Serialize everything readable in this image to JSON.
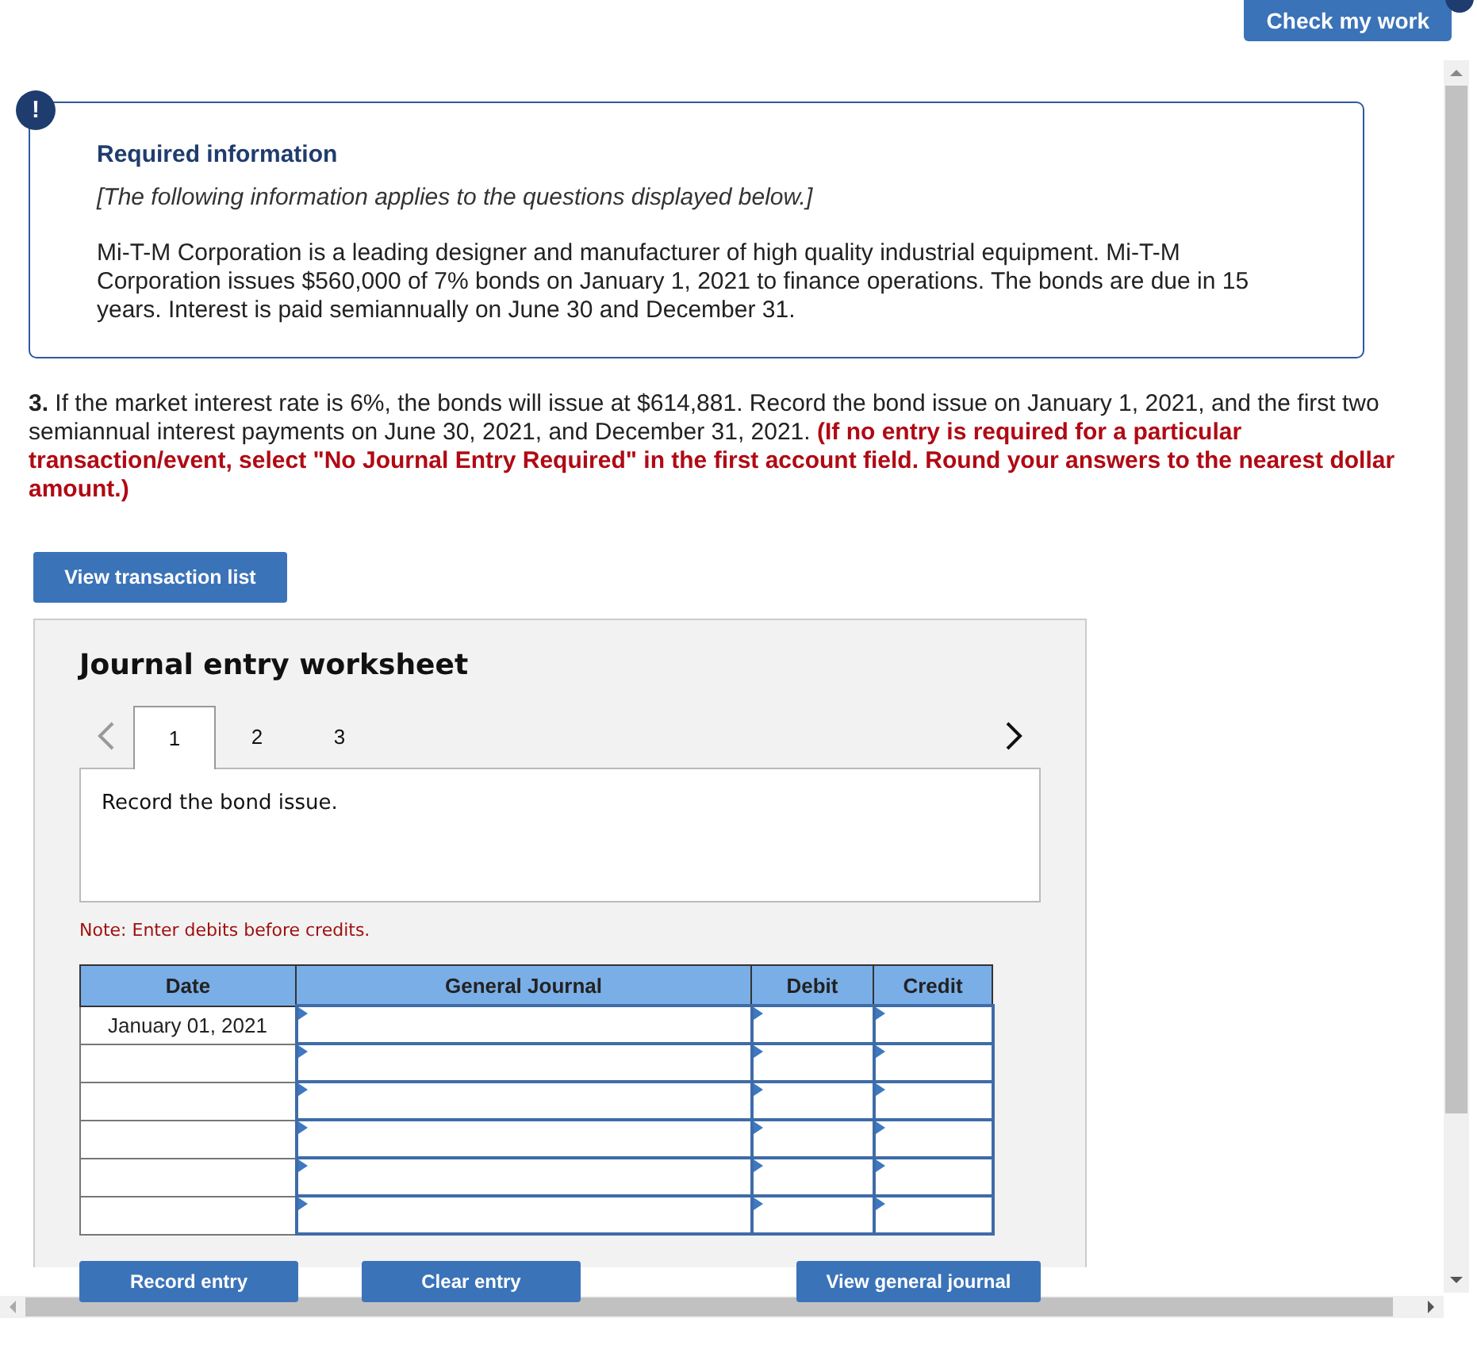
{
  "header": {
    "check_button": "Check my work"
  },
  "info": {
    "icon": "!",
    "title": "Required information",
    "note": "[The following information applies to the questions displayed below.]",
    "body": "Mi-T-M Corporation is a leading designer and manufacturer of high quality industrial equipment.  Mi-T-M Corporation issues $560,000 of 7% bonds on January 1, 2021 to finance operations.  The bonds are due in 15 years.  Interest is paid semiannually on June 30 and December 31."
  },
  "question": "**3.** If the market interest rate is 6%, the bonds will issue at $614,881. Record the bond issue on January 1, 2021, and the first two semiannual interest payments on June 30, 2021, and December 31, 2021. **(If no entry is required for a particular transaction/event, select \"No Journal Entry Required\" in the first account field. Round your answers to the nearest dollar amount.)**",
  "view_transactions_button": "View transaction list",
  "worksheet": {
    "title": "Journal entry worksheet",
    "tabs": [
      {
        "label": "1",
        "selected": true
      },
      {
        "label": "2",
        "selected": false
      },
      {
        "label": "3",
        "selected": false
      }
    ],
    "prompt": "Record the bond issue.",
    "note": "Note: Enter debits before credits.",
    "columns": [
      "Date",
      "General Journal",
      "Debit",
      "Credit"
    ],
    "rows": [
      {
        "date": "January 01, 2021"
      },
      {},
      {},
      {},
      {},
      {}
    ],
    "buttons": [
      "Record entry",
      "Clear entry",
      "View general journal"
    ]
  }
}
